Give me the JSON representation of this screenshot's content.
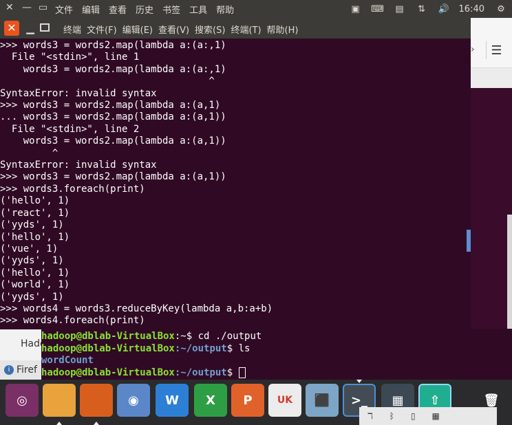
{
  "top_panel": {
    "menu": [
      "文件",
      "编辑",
      "查看",
      "历史",
      "书签",
      "工具",
      "帮助"
    ],
    "clock": "16:40"
  },
  "terminal": {
    "menu": [
      "终端",
      "文件(F)",
      "编辑(E)",
      "查看(V)",
      "搜索(S)",
      "终端(T)",
      "帮助(H)"
    ],
    "lines": [
      ">>> words3 = words2.map(lambda a:(a:,1)",
      "  File \"<stdin>\", line 1",
      "    words3 = words2.map(lambda a:(a:,1)",
      "                                    ^",
      "SyntaxError: invalid syntax",
      ">>> words3 = words2.map(lambda a:(a,1)",
      "... words3 = words2.map(lambda a:(a,1))",
      "  File \"<stdin>\", line 2",
      "    words3 = words2.map(lambda a:(a,1))",
      "         ^",
      "SyntaxError: invalid syntax",
      ">>> words3 = words2.map(lambda a:(a,1))",
      ">>> words3.foreach(print)",
      "('hello', 1)",
      "('react', 1)",
      "('yyds', 1)",
      "('hello', 1)",
      "('vue', 1)",
      "('yyds', 1)",
      "('hello', 1)",
      "('world', 1)",
      "('yyds', 1)",
      ">>> words4 = words3.reduceByKey(lambda a,b:a+b)",
      ">>> words4.foreach(print)"
    ]
  },
  "back_terminal": {
    "prompt_user": "hadoop@dblab-VirtualBox",
    "line1_path": ":~",
    "line1_cmd": "$ cd ./output",
    "line2_path": ":~/output",
    "line2_cmd": "$ ls",
    "ls_output": "wordCount",
    "line3_path": ":~/output",
    "line3_cmd": "$ "
  },
  "background": {
    "hado_text": "Hado",
    "firefox_text": "Firef"
  },
  "dock": {
    "items": [
      {
        "name": "ubuntu-logo",
        "glyph": "◎",
        "color": "#7a2f66"
      },
      {
        "name": "files",
        "glyph": "",
        "color": "#e8a33c"
      },
      {
        "name": "firefox",
        "glyph": "",
        "color": "#d85e1e"
      },
      {
        "name": "chromium",
        "glyph": "◉",
        "color": "#5b87c9"
      },
      {
        "name": "wps-writer",
        "glyph": "W",
        "color": "#2d7fd6"
      },
      {
        "name": "wps-spreadsheets",
        "glyph": "X",
        "color": "#2e9e45"
      },
      {
        "name": "wps-presentation",
        "glyph": "P",
        "color": "#e0612a"
      },
      {
        "name": "uk-software",
        "glyph": "UK",
        "color": "#ececec"
      },
      {
        "name": "install-drive",
        "glyph": "⬛",
        "color": "#7da6c6"
      },
      {
        "name": "terminal",
        "glyph": ">_",
        "color": "#434c55"
      },
      {
        "name": "workspace-switcher",
        "glyph": "▦",
        "color": "#3d4855"
      },
      {
        "name": "update-manager",
        "glyph": "⇧",
        "color": "#1fae8f"
      },
      {
        "name": "trash",
        "glyph": "🗑",
        "color": "#2b2a2c"
      }
    ]
  }
}
